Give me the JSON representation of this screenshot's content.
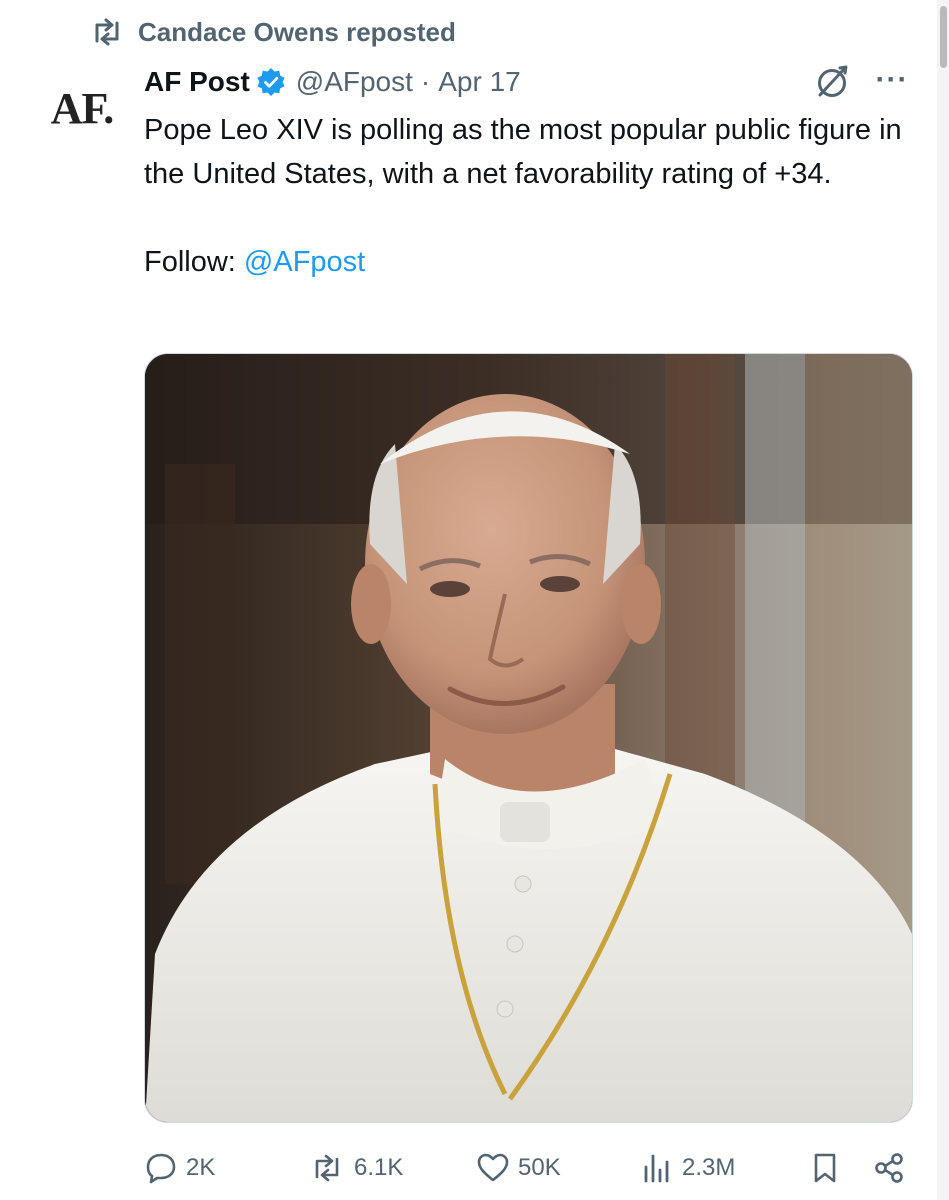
{
  "repost": {
    "label": "Candace Owens reposted"
  },
  "tweet": {
    "avatar_text": "AF.",
    "author_name": "AF Post",
    "handle": "@AFpost",
    "separator": "·",
    "date": "Apr 17",
    "body": "Pope Leo XIV is polling as the most popular public figure in the United States, with a net favorability rating of +34.",
    "follow_prefix": "Follow: ",
    "follow_mention": "@AFpost"
  },
  "actions": {
    "replies": "2K",
    "reposts": "6.1K",
    "likes": "50K",
    "views": "2.3M"
  },
  "icons": [
    "repost-icon",
    "verified-badge-icon",
    "grok-icon",
    "more-icon",
    "reply-icon",
    "like-icon",
    "views-icon",
    "bookmark-icon",
    "share-icon"
  ],
  "colors": {
    "accent": "#1d9bf0",
    "secondary_text": "#536471",
    "primary_text": "#0f1419"
  }
}
